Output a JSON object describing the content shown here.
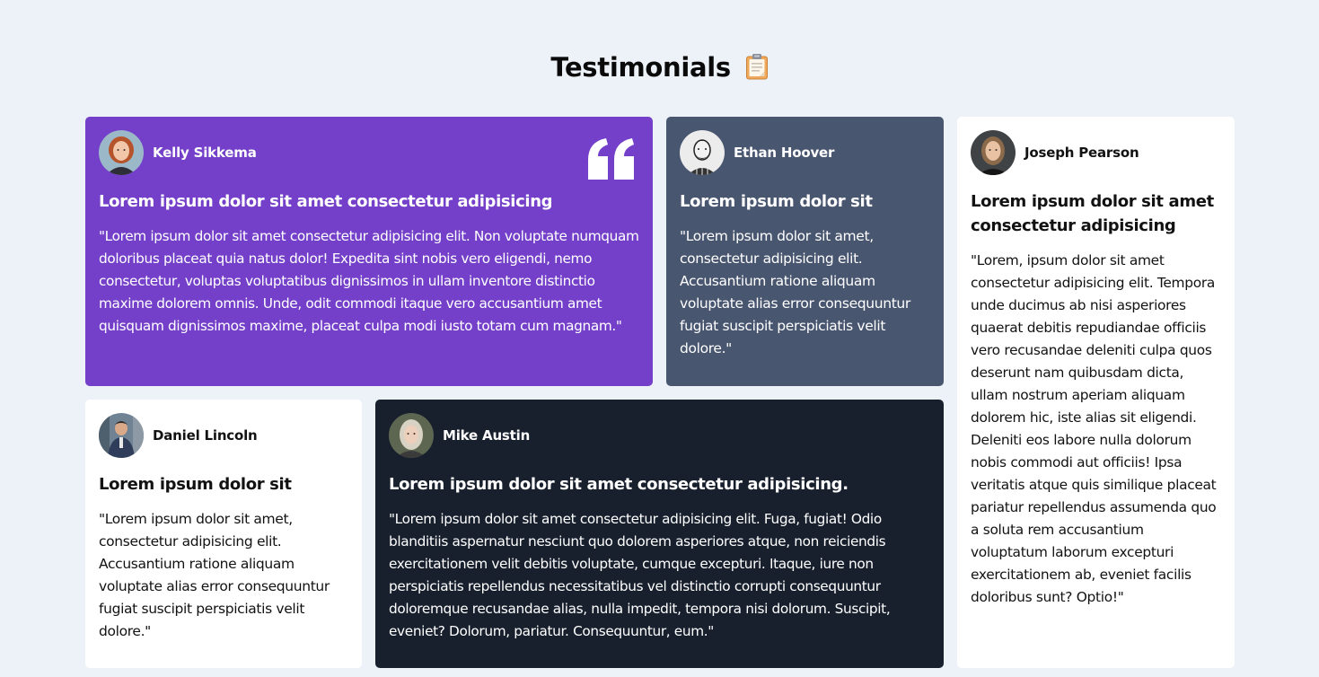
{
  "page": {
    "title": "Testimonials",
    "title_icon": "clipboard-icon"
  },
  "colors": {
    "background": "#edf2f8",
    "purple": "#7540c9",
    "slate": "#495670",
    "dark": "#18202e",
    "white": "#ffffff"
  },
  "testimonials": [
    {
      "name": "Kelly Sikkema",
      "heading": "Lorem ipsum dolor sit amet consectetur adipisicing",
      "body": "\"Lorem ipsum dolor sit amet consectetur adipisicing elit. Non voluptate numquam doloribus placeat quia natus dolor! Expedita sint nobis vero eligendi, nemo consectetur, voluptas voluptatibus dignissimos in ullam inventore distinctio maxime dolorem omnis. Unde, odit commodi itaque vero accusantium amet quisquam dignissimos maxime, placeat culpa modi iusto totam cum magnam.\"",
      "theme": "purple",
      "icon": "quote-icon"
    },
    {
      "name": "Ethan Hoover",
      "heading": "Lorem ipsum dolor sit",
      "body": "\"Lorem ipsum dolor sit amet, consectetur adipisicing elit. Accusantium ratione aliquam voluptate alias error consequuntur fugiat suscipit perspiciatis velit dolore.\"",
      "theme": "slate"
    },
    {
      "name": "Joseph Pearson",
      "heading": "Lorem ipsum dolor sit amet consectetur adipisicing",
      "body": "\"Lorem, ipsum dolor sit amet consectetur adipisicing elit. Tempora unde ducimus ab nisi asperiores quaerat debitis repudiandae officiis vero recusandae deleniti culpa quos deserunt nam quibusdam dicta, ullam nostrum aperiam aliquam dolorem hic, iste alias sit eligendi. Deleniti eos labore nulla dolorum nobis commodi aut officiis! Ipsa veritatis atque quis similique placeat pariatur repellendus assumenda quo a soluta rem accusantium voluptatum laborum excepturi exercitationem ab, eveniet facilis doloribus sunt? Optio!\"",
      "theme": "white"
    },
    {
      "name": "Daniel Lincoln",
      "heading": "Lorem ipsum dolor sit",
      "body": "\"Lorem ipsum dolor sit amet, consectetur adipisicing elit. Accusantium ratione aliquam voluptate alias error consequuntur fugiat suscipit perspiciatis velit dolore.\"",
      "theme": "white"
    },
    {
      "name": "Mike Austin",
      "heading": "Lorem ipsum dolor sit amet consectetur adipisicing.",
      "body": "\"Lorem ipsum dolor sit amet consectetur adipisicing elit. Fuga, fugiat! Odio blanditiis aspernatur nesciunt quo dolorem asperiores atque, non reiciendis exercitationem velit debitis voluptate, cumque excepturi. Itaque, iure non perspiciatis repellendus necessitatibus vel distinctio corrupti consequuntur doloremque recusandae alias, nulla impedit, tempora nisi dolorum. Suscipit, eveniet? Dolorum, pariatur. Consequuntur, eum.\"",
      "theme": "dark"
    }
  ]
}
